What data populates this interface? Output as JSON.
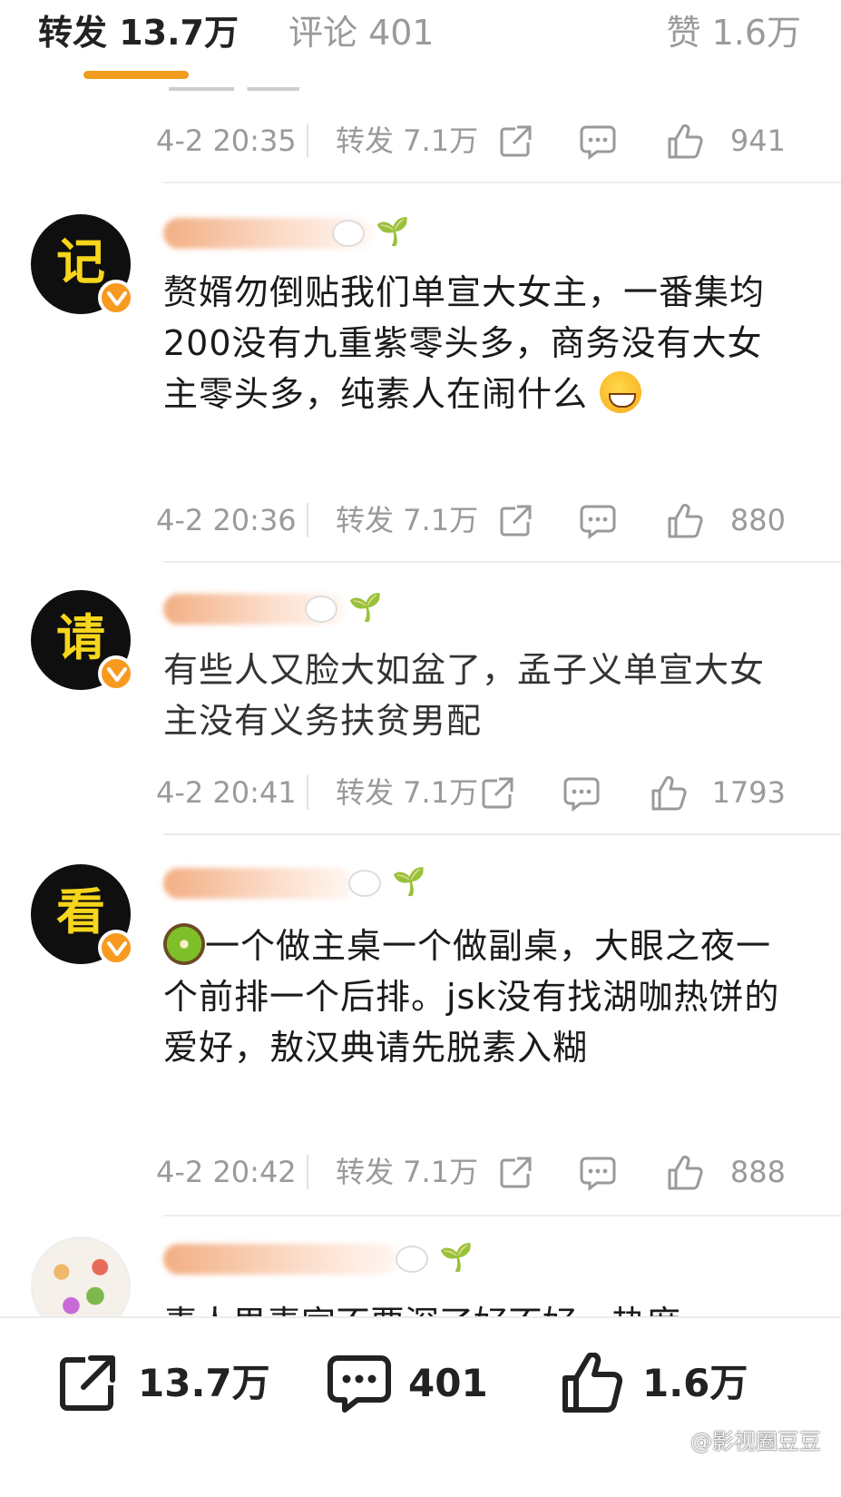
{
  "tabs": {
    "reposts": "转发 13.7万",
    "comments": "评论 401",
    "likes": "赞 1.6万"
  },
  "accent_color": "#f29c1f",
  "comments": [
    {
      "time": "4-2 20:35",
      "repost": "转发 7.1万",
      "likes": "941"
    },
    {
      "avatar_char": "记",
      "text": "赘婿勿倒贴我们单宣大女主，一番集均200没有九重紫零头多，商务没有大女主零头多，纯素人在闹什么",
      "emoji": "grinning-sweat-emoji",
      "time": "4-2 20:36",
      "repost": "转发 7.1万",
      "likes": "880"
    },
    {
      "avatar_char": "请",
      "text": "有些人又脸大如盆了，孟子义单宣大女主没有义务扶贫男配",
      "time": "4-2 20:41",
      "repost": "转发 7.1万",
      "likes": "1793"
    },
    {
      "avatar_char": "看",
      "emoji": "kiwi-emoji",
      "text": "一个做主桌一个做副桌，大眼之夜一个前排一个后排。jsk没有找湖咖热饼的爱好，敖汉典请先脱素入糊",
      "time": "4-2 20:42",
      "repost": "转发 7.1万",
      "likes": "888"
    }
  ],
  "partial_text": "素人男素宣不要深了好不好，热度",
  "bottom_bar": {
    "repost": "13.7万",
    "comments": "401",
    "likes": "1.6万"
  },
  "watermark": "@影视圈豆豆"
}
